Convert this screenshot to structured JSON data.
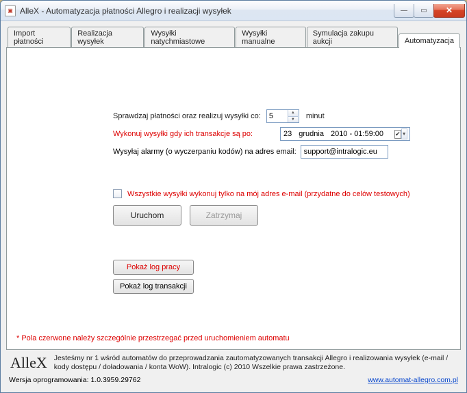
{
  "window": {
    "title": "AlleX - Automatyzacja płatności Allegro i realizacji wysyłek"
  },
  "tabs": [
    {
      "label": "Import płatności"
    },
    {
      "label": "Realizacja wysyłek"
    },
    {
      "label": "Wysyłki natychmiastowe"
    },
    {
      "label": "Wysyłki manualne"
    },
    {
      "label": "Symulacja zakupu aukcji"
    },
    {
      "label": "Automatyzacja"
    }
  ],
  "form": {
    "interval_label": "Sprawdzaj płatności oraz realizuj wysyłki co:",
    "interval_value": "5",
    "interval_unit": "minut",
    "after_label": "Wykonuj wysyłki gdy ich transakcje są po:",
    "after_day": "23",
    "after_month": "grudnia",
    "after_year_time": "2010 - 01:59:00",
    "email_label": "Wysyłaj alarmy (o wyczerpaniu kodów) na adres email:",
    "email_value": "support@intralogic.eu",
    "test_checkbox_label": "Wszystkie wysyłki wykonuj tylko na mój adres e-mail (przydatne do celów testowych)",
    "run_label": "Uruchom",
    "stop_label": "Zatrzymaj",
    "show_log_work": "Pokaż log pracy",
    "show_log_tx": "Pokaż log transakcji",
    "warning": "* Pola czerwone należy szczególnie przestrzegać przed uruchomieniem automatu"
  },
  "footer": {
    "brand": "AlleX",
    "slogan": "Jesteśmy nr 1 wśród automatów do przeprowadzania zautomatyzowanych transakcji Allegro i realizowania wysyłek (e-mail / kody dostępu / doładowania / konta WoW).  Intralogic (c) 2010 Wszelkie prawa zastrzeżone.",
    "version_label": "Wersja oprogramowania: 1.0.3959.29762",
    "link": "www.automat-allegro.com.pl"
  }
}
